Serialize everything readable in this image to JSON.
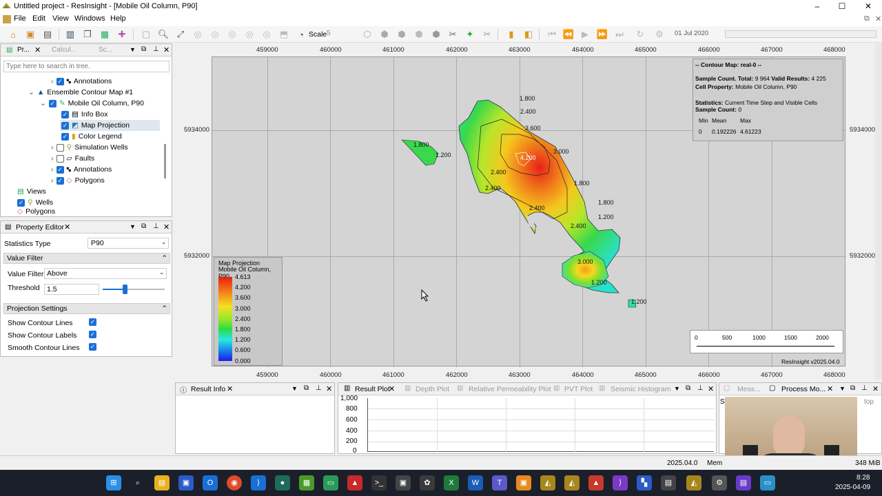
{
  "window": {
    "title": "Untitled project - ResInsight - [Mobile Oil Column, P90]",
    "min": "–",
    "max": "☐",
    "close": "✕"
  },
  "menu": [
    "File",
    "Edit",
    "View",
    "Windows",
    "Help"
  ],
  "toolbar": {
    "scale_label": "Scale",
    "scale_value": "5",
    "date": "01 Jul 2020"
  },
  "project_panel": {
    "tabs": [
      "Pr...",
      "Calcul...",
      "Sc..."
    ],
    "search_placeholder": "Type here to search in tree.",
    "tree": [
      {
        "label": "Annotations",
        "checked": true,
        "icon": "annotation-icon"
      },
      {
        "label": "Ensemble Contour Map #1",
        "icon": "contour-map-icon"
      },
      {
        "label": "Mobile Oil Column, P90",
        "checked": true,
        "icon": "edit-icon"
      },
      {
        "label": "Info Box",
        "checked": true,
        "icon": "infobox-icon"
      },
      {
        "label": "Map Projection",
        "checked": true,
        "icon": "map-icon"
      },
      {
        "label": "Color Legend",
        "checked": true,
        "icon": "legend-icon"
      },
      {
        "label": "Simulation Wells",
        "checked": false,
        "icon": "wells-icon"
      },
      {
        "label": "Faults",
        "checked": false,
        "icon": "faults-icon"
      },
      {
        "label": "Annotations",
        "checked": true,
        "icon": "annotation-icon"
      },
      {
        "label": "Polygons",
        "checked": true,
        "icon": "polygon-icon"
      },
      {
        "label": "Views",
        "icon": "views-icon"
      },
      {
        "label": "Wells",
        "checked": true,
        "icon": "wells-icon"
      },
      {
        "label": "Polygons",
        "icon": "polygon-icon"
      }
    ]
  },
  "property_editor": {
    "title": "Property Editor",
    "statistics_type_label": "Statistics Type",
    "statistics_type": "P90",
    "value_filter_section": "Value Filter",
    "value_filter_label": "Value Filter",
    "value_filter": "Above",
    "threshold_label": "Threshold",
    "threshold": "1.5",
    "threshold_fraction": 0.35,
    "projection_section": "Projection Settings",
    "settings": [
      {
        "label": "Show Contour Lines",
        "checked": true
      },
      {
        "label": "Show Contour Labels",
        "checked": true
      },
      {
        "label": "Smooth Contour Lines",
        "checked": true
      }
    ]
  },
  "map": {
    "x_ticks": [
      "459000",
      "460000",
      "461000",
      "462000",
      "463000",
      "464000",
      "465000",
      "466000",
      "467000",
      "468000"
    ],
    "y_ticks": [
      "5934000",
      "5932000"
    ],
    "info": {
      "line1": "-- Contour Map: real-0 --",
      "line2a": "Sample Count. Total:",
      "line2b": "9 964",
      "line2c": "Valid Results:",
      "line2d": "4 225",
      "line3a": "Cell Property:",
      "line3b": "Mobile Oil Column, P90",
      "line4a": "Statistics:",
      "line4b": "Current Time Step and Visible Cells",
      "line5a": "Sample Count:",
      "line5b": "0",
      "cols": [
        "Min",
        "Mean",
        "Max"
      ],
      "vals": [
        "0",
        "0.192226",
        "4.61223"
      ]
    },
    "legend": {
      "title1": "Map Projection",
      "title2": "Mobile Oil Column, P90",
      "labels": [
        "4.613",
        "4.200",
        "3.600",
        "3.000",
        "2.400",
        "1.800",
        "1.200",
        "0.600",
        "0.000"
      ]
    },
    "scalebar": [
      "0",
      "500",
      "1000",
      "1500",
      "2000"
    ],
    "version": "ResInsight v2025.04.0",
    "contour_labels": [
      "1.800",
      "2.400",
      "3.600",
      "4.200",
      "3.000",
      "1.800",
      "2.400",
      "1.200",
      "3.000",
      "2.400",
      "1.200",
      "1.800",
      "1.200",
      "1.800",
      "1.200",
      "2.400",
      "3.000"
    ]
  },
  "bottom": {
    "result_info": "Result Info",
    "tabs": [
      "Result Plot",
      "Depth Plot",
      "Relative Permeability Plot",
      "PVT Plot",
      "Seismic Histogram"
    ],
    "y_ticks": [
      "1,000",
      "800",
      "600",
      "400",
      "200",
      "0"
    ],
    "msg_tab": "Mess...",
    "process_tab": "Process Mo...",
    "partial_st": "St",
    "partial_top": "top"
  },
  "status": {
    "version": "2025.04.0",
    "mem": "Mem",
    "mib": "348 MiB"
  },
  "taskbar": {
    "time": "8:28",
    "date": "2025-04-09"
  }
}
